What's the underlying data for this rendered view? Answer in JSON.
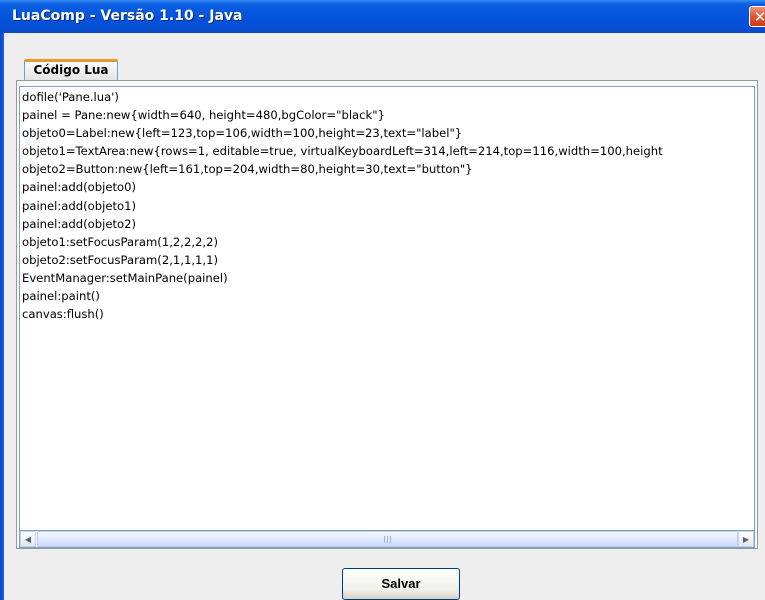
{
  "window": {
    "title": "LuaComp - Versão 1.10 - Java",
    "close_glyph": "✕"
  },
  "tabs": [
    {
      "label": "Código Lua",
      "selected": true
    }
  ],
  "editor": {
    "lines": [
      "dofile('Pane.lua')",
      "painel = Pane:new{width=640, height=480,bgColor=\"black\"}",
      "objeto0=Label:new{left=123,top=106,width=100,height=23,text=\"label\"}",
      "objeto1=TextArea:new{rows=1, editable=true, virtualKeyboardLeft=314,left=214,top=116,width=100,height",
      "objeto2=Button:new{left=161,top=204,width=80,height=30,text=\"button\"}",
      "painel:add(objeto0)",
      "painel:add(objeto1)",
      "painel:add(objeto2)",
      "objeto1:setFocusParam(1,2,2,2,2)",
      "objeto2:setFocusParam(2,1,1,1,1)",
      "EventManager:setMainPane(painel)",
      "painel:paint()",
      "canvas:flush()"
    ]
  },
  "scrollbar": {
    "left_arrow": "◀",
    "right_arrow": "▶",
    "position": 0.0
  },
  "buttons": {
    "save_label": "Salvar"
  },
  "colors": {
    "titlebar": "#0554dd",
    "tab_accent": "#e89a2c",
    "close_button": "#e2552c"
  }
}
